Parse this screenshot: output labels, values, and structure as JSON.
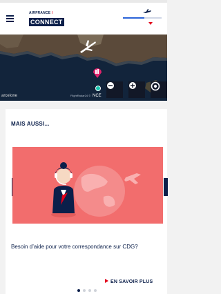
{
  "header": {
    "brand_line": "AIRFRANCE",
    "brand_name": "CONNECT",
    "flight_progress": 0.55
  },
  "map": {
    "city": "NCE",
    "barcelona_label": "arcelone",
    "credit": "FlightRadar24 ©"
  },
  "section": {
    "title": "MAIS AUSSI..."
  },
  "promo": {
    "text": "Besoin d’aide pour votre correspondance sur CDG?",
    "cta_label": "EN SAVOIR PLUS"
  },
  "pagination": {
    "count": 4,
    "active": 0
  }
}
